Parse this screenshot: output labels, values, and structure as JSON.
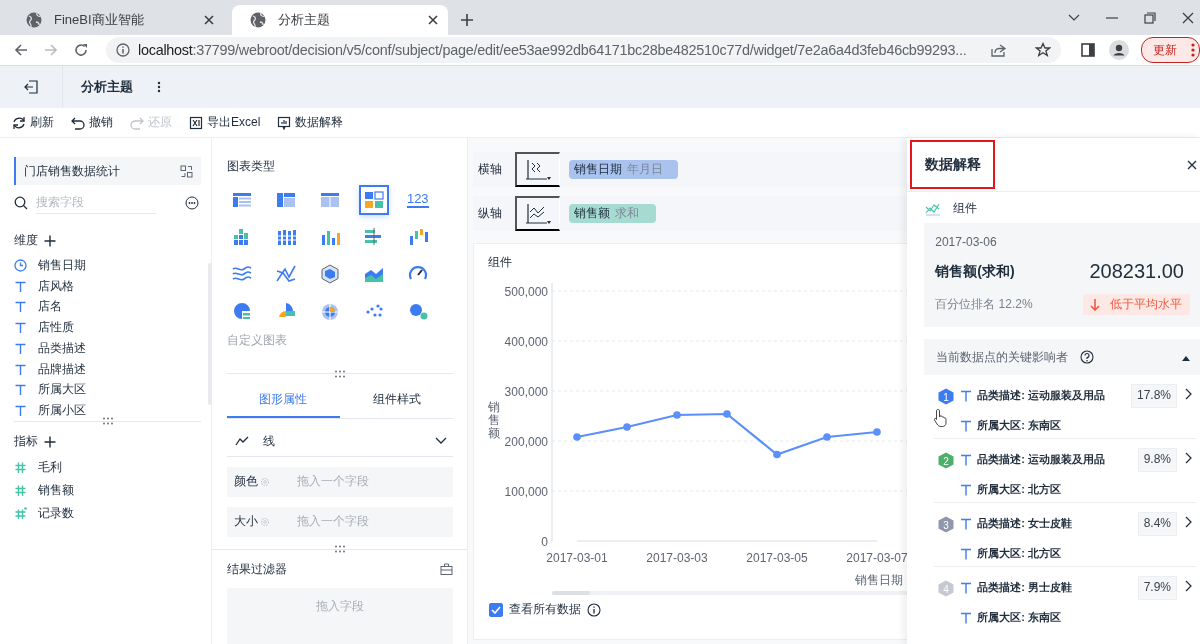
{
  "browser": {
    "tabs": [
      {
        "title": "FineBI商业智能",
        "selected": false
      },
      {
        "title": "分析主题",
        "selected": true
      }
    ],
    "address": {
      "host": "localhost",
      "path": ":37799/webroot/decision/v5/conf/subject/page/edit/ee53ae992db64171bc28be482510c77d/widget/7e2a6a4d3feb46cb99293..."
    },
    "update_button": "更新"
  },
  "header": {
    "title": "分析主题"
  },
  "toolbar": [
    {
      "label": "刷新",
      "kind": "refresh",
      "disabled": false
    },
    {
      "label": "撤销",
      "kind": "undo",
      "disabled": false
    },
    {
      "label": "还原",
      "kind": "redo",
      "disabled": true
    },
    {
      "label": "导出Excel",
      "kind": "excel",
      "disabled": false
    },
    {
      "label": "数据解释",
      "kind": "explain",
      "disabled": false
    }
  ],
  "fields_panel": {
    "dataset": "门店销售数据统计",
    "search_placeholder": "搜索字段",
    "dimensions": {
      "title": "维度",
      "items": [
        {
          "name": "销售日期",
          "kind": "date"
        },
        {
          "name": "店风格",
          "kind": "text"
        },
        {
          "name": "店名",
          "kind": "text"
        },
        {
          "name": "店性质",
          "kind": "text"
        },
        {
          "name": "品类描述",
          "kind": "text"
        },
        {
          "name": "品牌描述",
          "kind": "text"
        },
        {
          "name": "所属大区",
          "kind": "text"
        },
        {
          "name": "所属小区",
          "kind": "text"
        }
      ]
    },
    "measures": {
      "title": "指标",
      "items": [
        {
          "name": "毛利",
          "kind": "number"
        },
        {
          "name": "销售额",
          "kind": "number"
        },
        {
          "name": "记录数",
          "kind": "count"
        }
      ]
    }
  },
  "chart_types": {
    "title": "图表类型",
    "custom_label": "自定义图表",
    "types": [
      {
        "kind": "table",
        "selected": false
      },
      {
        "kind": "crosstable",
        "selected": false
      },
      {
        "kind": "detail",
        "selected": false
      },
      {
        "kind": "dashboard",
        "selected": true
      },
      {
        "kind": "number",
        "label": "123",
        "selected": false
      },
      {
        "kind": "grouped-bar",
        "selected": false
      },
      {
        "kind": "stacked-bar",
        "selected": false
      },
      {
        "kind": "bar",
        "selected": false
      },
      {
        "kind": "hbar",
        "selected": false
      },
      {
        "kind": "waterfall",
        "selected": false
      },
      {
        "kind": "wave",
        "selected": false
      },
      {
        "kind": "cross",
        "selected": false
      },
      {
        "kind": "radar",
        "selected": false
      },
      {
        "kind": "area",
        "selected": false
      },
      {
        "kind": "gauge",
        "selected": false
      },
      {
        "kind": "pie",
        "selected": false
      },
      {
        "kind": "rose",
        "selected": false
      },
      {
        "kind": "sunburst",
        "selected": false
      },
      {
        "kind": "scatter",
        "selected": false
      },
      {
        "kind": "bubble",
        "selected": false
      }
    ]
  },
  "properties": {
    "tabs": [
      {
        "label": "图形属性",
        "selected": true
      },
      {
        "label": "组件样式",
        "selected": false
      }
    ],
    "mark_type": "线",
    "slots": [
      {
        "label": "颜色",
        "placeholder": "拖入一个字段"
      },
      {
        "label": "大小",
        "placeholder": "拖入一个字段"
      }
    ]
  },
  "result_filter": {
    "title": "结果过滤器",
    "placeholder": "拖入字段"
  },
  "axes": [
    {
      "label": "横轴",
      "field": "销售日期",
      "aggregation": "年月日",
      "kind": "dimension"
    },
    {
      "label": "纵轴",
      "field": "销售额",
      "aggregation": "求和",
      "kind": "measure"
    }
  ],
  "widget": {
    "title": "组件",
    "chart_data": {
      "type": "line",
      "xlabel": "销售日期",
      "ylabel": "销售额",
      "x": [
        "2017-03-01",
        "2017-03-02",
        "2017-03-03",
        "2017-03-04",
        "2017-03-05",
        "2017-03-06",
        "2017-03-07"
      ],
      "xlim": [
        "2017-03-01",
        "2017-03-07"
      ],
      "xticks": [
        "2017-03-01",
        "2017-03-03",
        "2017-03-05",
        "2017-03-07"
      ],
      "grid": true,
      "ylim": [
        0,
        500000
      ],
      "yticks": [
        {
          "value": 0,
          "label": "0"
        },
        {
          "value": 100000,
          "label": "100,000"
        },
        {
          "value": 200000,
          "label": "200,000"
        },
        {
          "value": 300000,
          "label": "300,000"
        },
        {
          "value": 400000,
          "label": "400,000"
        },
        {
          "value": 500000,
          "label": "500,000"
        }
      ],
      "series": [
        {
          "color": "#5b8ff9",
          "marker": "circle",
          "values": [
            208000,
            228000,
            252000,
            254000,
            173000,
            208000,
            218000
          ]
        }
      ]
    },
    "show_all": {
      "label": "查看所有数据",
      "checked": true
    }
  },
  "explain_panel": {
    "title": "数据解释",
    "component": "组件",
    "point": {
      "date": "2017-03-06",
      "measure": "销售额(求和)",
      "value": "208231.00",
      "rank": "百分位排名 12.2%",
      "verdict": "低于平均水平"
    },
    "influencers": {
      "title": "当前数据点的关键影响者",
      "expanded": true,
      "items": [
        {
          "rank": "1",
          "color": "#3d7cf0",
          "conditions": [
            "品类描述: 运动服装及用品",
            "所属大区: 东南区"
          ],
          "share": "17.8%"
        },
        {
          "rank": "2",
          "color": "#4caf6a",
          "conditions": [
            "品类描述: 运动服装及用品",
            "所属大区: 北方区"
          ],
          "share": "9.8%"
        },
        {
          "rank": "3",
          "color": "#8e97ab",
          "conditions": [
            "品类描述: 女士皮鞋",
            "所属大区: 北方区"
          ],
          "share": "8.4%"
        },
        {
          "rank": "4",
          "color": "#c4c8d0",
          "conditions": [
            "品类描述: 男士皮鞋",
            "所属大区: 东南区"
          ],
          "share": "7.9%"
        }
      ]
    }
  }
}
